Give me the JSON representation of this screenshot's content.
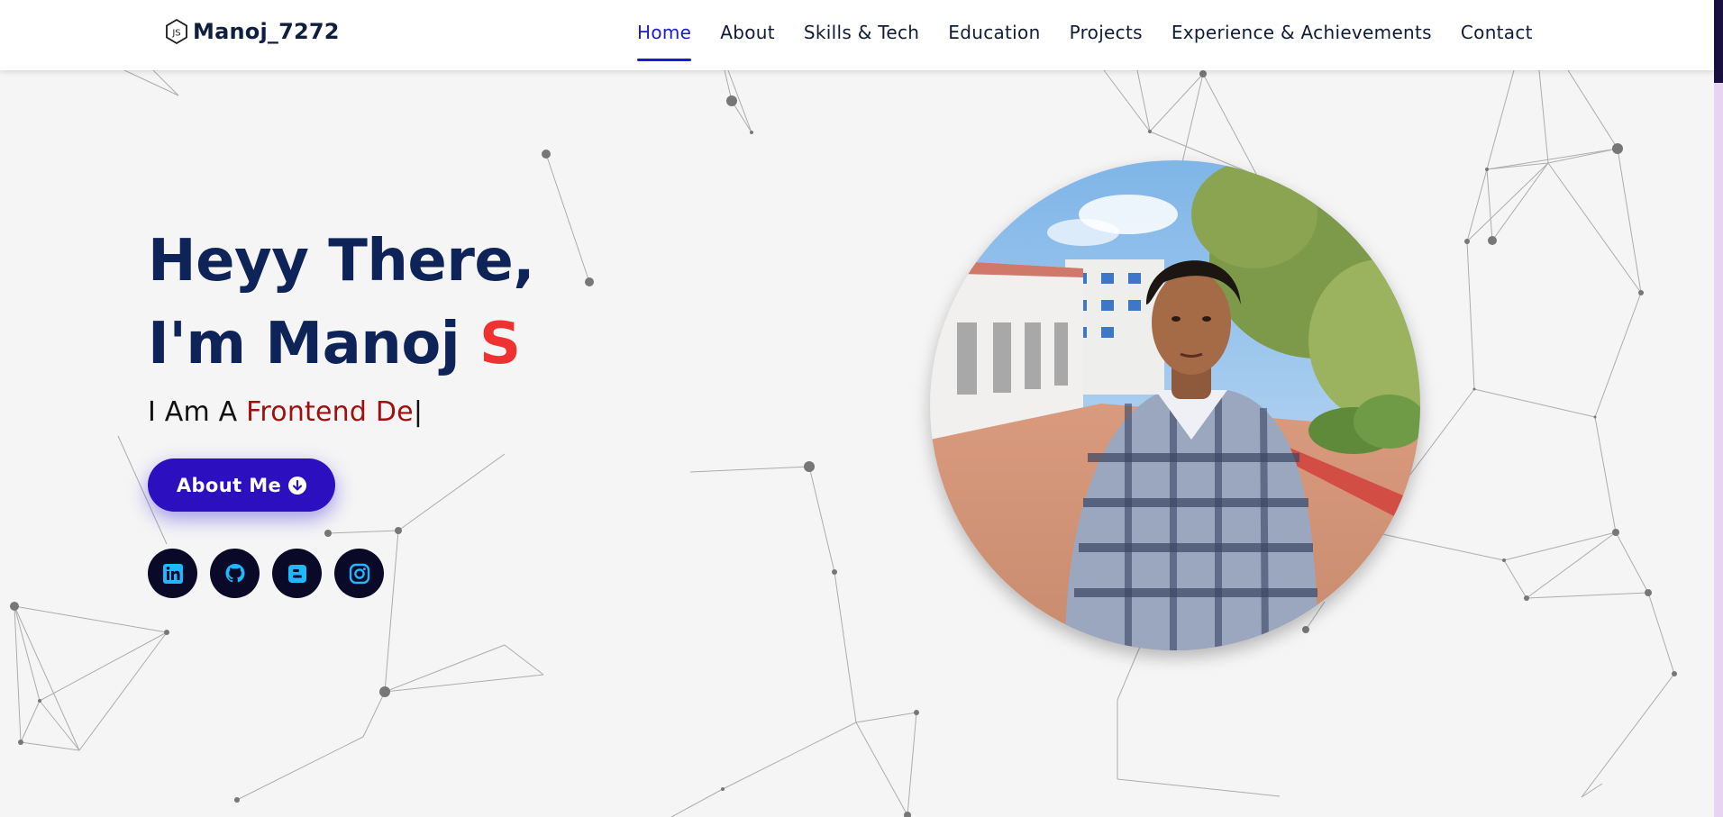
{
  "logo": {
    "text": "Manoj_7272",
    "icon": "nodejs-hexagon-icon"
  },
  "nav": {
    "items": [
      {
        "label": "Home",
        "active": true
      },
      {
        "label": "About",
        "active": false
      },
      {
        "label": "Skills & Tech",
        "active": false
      },
      {
        "label": "Education",
        "active": false
      },
      {
        "label": "Projects",
        "active": false
      },
      {
        "label": "Experience & Achievements",
        "active": false
      },
      {
        "label": "Contact",
        "active": false
      }
    ]
  },
  "hero": {
    "greeting": "Heyy There,",
    "intro": "I'm Manoj ",
    "initial": "S",
    "typed_prefix": "I Am A ",
    "typed_role": "Frontend De",
    "typed_caret": "|",
    "button_label": "About Me",
    "button_icon": "arrow-circle-down-icon"
  },
  "socials": [
    {
      "name": "linkedin",
      "icon": "linkedin-icon"
    },
    {
      "name": "github",
      "icon": "github-icon"
    },
    {
      "name": "blogger",
      "icon": "blogger-icon"
    },
    {
      "name": "instagram",
      "icon": "instagram-icon"
    }
  ],
  "colors": {
    "accent": "#1c1ad4",
    "heading": "#0e2459",
    "initial": "#f03131",
    "role": "#a01010",
    "button": "#2c0fbf",
    "social_bg": "#0a0a28",
    "social_icon": "#1fb8ff",
    "background": "#f5f5f5"
  }
}
